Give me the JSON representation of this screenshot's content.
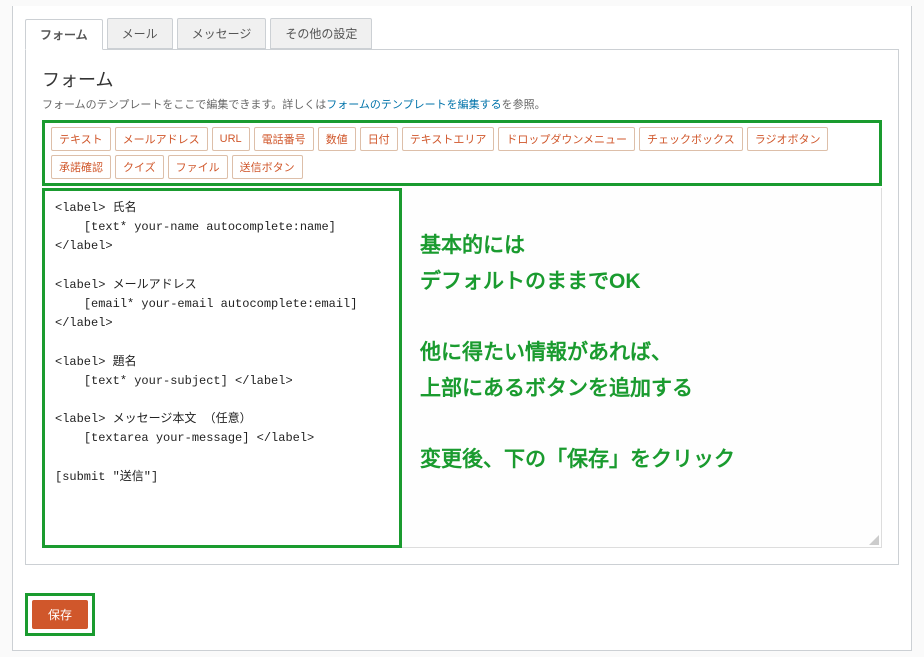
{
  "tabs": {
    "items": [
      {
        "label": "フォーム",
        "active": true
      },
      {
        "label": "メール",
        "active": false
      },
      {
        "label": "メッセージ",
        "active": false
      },
      {
        "label": "その他の設定",
        "active": false
      }
    ]
  },
  "section": {
    "title": "フォーム",
    "desc_pre": "フォームのテンプレートをここで編集できます。詳しくは",
    "desc_link": "フォームのテンプレートを編集する",
    "desc_post": "を参照。"
  },
  "tag_buttons": [
    "テキスト",
    "メールアドレス",
    "URL",
    "電話番号",
    "数値",
    "日付",
    "テキストエリア",
    "ドロップダウンメニュー",
    "チェックボックス",
    "ラジオボタン",
    "承諾確認",
    "クイズ",
    "ファイル",
    "送信ボタン"
  ],
  "form_template": "<label> 氏名\n    [text* your-name autocomplete:name] </label>\n\n<label> メールアドレス\n    [email* your-email autocomplete:email] </label>\n\n<label> 題名\n    [text* your-subject] </label>\n\n<label> メッセージ本文 （任意）\n    [textarea your-message] </label>\n\n[submit \"送信\"]",
  "annotation": {
    "line1": "基本的には",
    "line2": "デフォルトのままでOK",
    "line3": "他に得たい情報があれば、",
    "line4": "上部にあるボタンを追加する",
    "line5": "変更後、下の「保存」をクリック"
  },
  "save_label": "保存"
}
